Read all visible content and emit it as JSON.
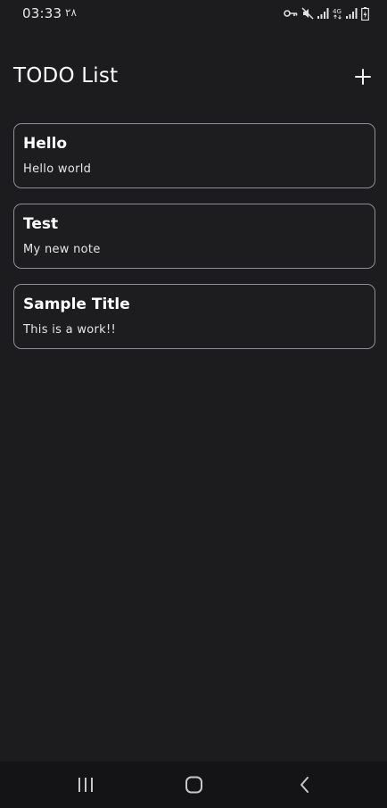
{
  "status_bar": {
    "time": "03:33",
    "notification_text": "۲۸",
    "icons": [
      "key-icon",
      "mute-icon",
      "signal-icon",
      "4g-icon",
      "signal-icon",
      "battery-icon"
    ],
    "network_label": "4G"
  },
  "header": {
    "title": "TODO List",
    "add_icon": "plus-icon"
  },
  "notes": [
    {
      "title": "Hello",
      "body": "Hello world"
    },
    {
      "title": "Test",
      "body": "My new note"
    },
    {
      "title": "Sample Title",
      "body": "This is a work!!"
    }
  ],
  "nav_bar": {
    "icons": [
      "recents-icon",
      "home-icon",
      "back-icon"
    ]
  },
  "colors": {
    "background": "#1c1c1e",
    "card_border": "#8f8f94",
    "text": "#ffffff",
    "nav_background": "#141416"
  }
}
